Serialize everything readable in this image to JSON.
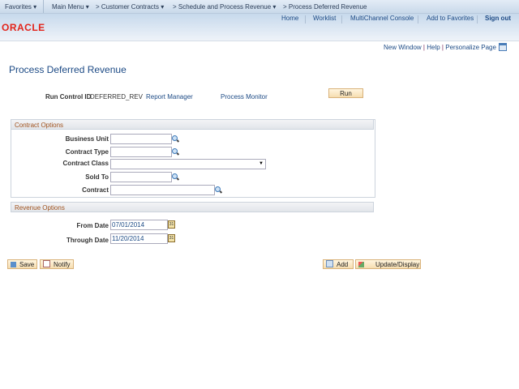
{
  "nav": {
    "favorites": "Favorites ▾",
    "main_menu": "Main Menu ▾",
    "crumb1": "> Customer Contracts ▾",
    "crumb2": "> Schedule and Process Revenue ▾",
    "crumb3": "> Process Deferred Revenue"
  },
  "header": {
    "links": [
      "Home",
      "Worklist",
      "MultiChannel Console",
      "Add to Favorites"
    ],
    "sign_out": "Sign out",
    "logo": "ORACLE"
  },
  "page_links": {
    "new_window": "New Window",
    "help": "Help",
    "personalize": "Personalize Page"
  },
  "title": "Process Deferred Revenue",
  "run_control": {
    "label": "Run Control ID",
    "value": "DEFERRED_REV",
    "report_manager": "Report Manager",
    "process_monitor": "Process Monitor",
    "run": "Run"
  },
  "contract_options": {
    "title": "Contract Options",
    "business_unit": "Business Unit",
    "contract_type": "Contract Type",
    "contract_class": "Contract Class",
    "sold_to": "Sold To",
    "contract": "Contract"
  },
  "revenue_options": {
    "title": "Revenue Options",
    "from_date_label": "From Date",
    "from_date": "07/01/2014",
    "through_date_label": "Through Date",
    "through_date": "11/20/2014"
  },
  "buttons": {
    "save": "Save",
    "notify": "Notify",
    "add": "Add",
    "update_display": "Update/Display"
  },
  "colors": {
    "link": "#1c4a85",
    "section_title": "#a0521d",
    "brand": "#e2231a"
  }
}
